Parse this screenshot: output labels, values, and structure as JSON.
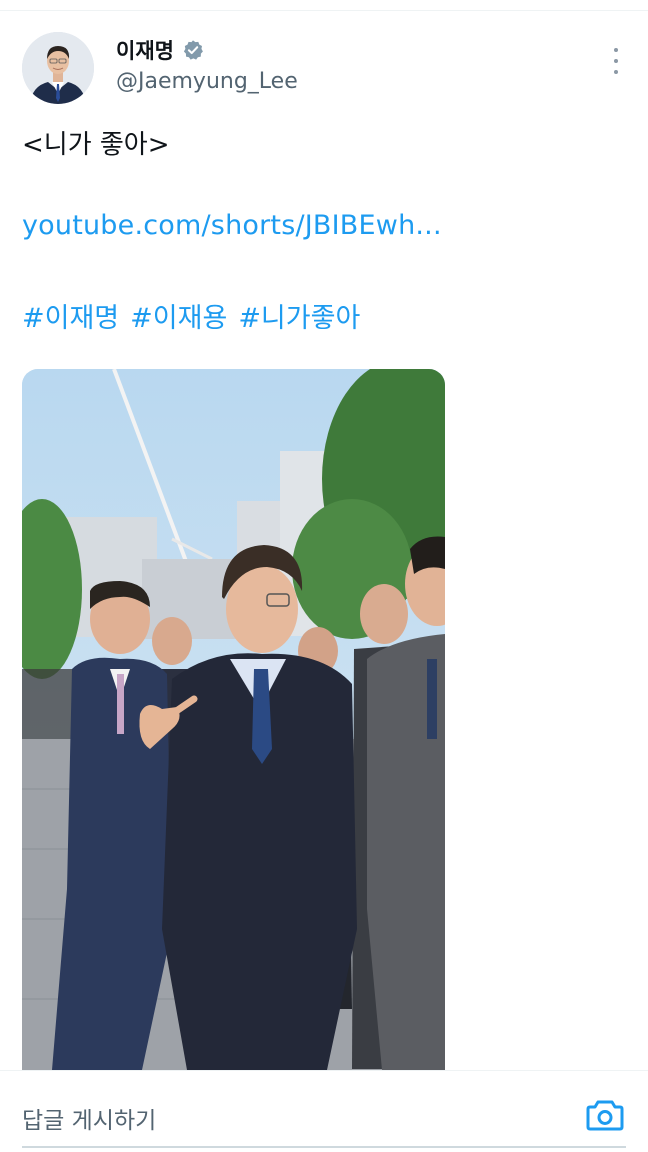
{
  "tweet": {
    "author": {
      "display_name": "이재명",
      "handle": "@Jaemyung_Lee",
      "verified": true,
      "avatar": "avatar"
    },
    "title_text": "<니가 좋아>",
    "link_text": "youtube.com/shorts/JBIBEwh...",
    "hashtags": [
      "#이재명",
      "#이재용",
      "#니가좋아"
    ],
    "media": {
      "type": "video-thumbnail"
    }
  },
  "reply": {
    "placeholder": "답글 게시하기",
    "camera_icon": "camera-icon"
  },
  "colors": {
    "link": "#1d9bf0",
    "text": "#0f1419",
    "muted": "#536471",
    "verified_badge": "#829aab"
  },
  "icons": {
    "verified": "verified-badge-icon",
    "more": "more-vertical-icon"
  }
}
